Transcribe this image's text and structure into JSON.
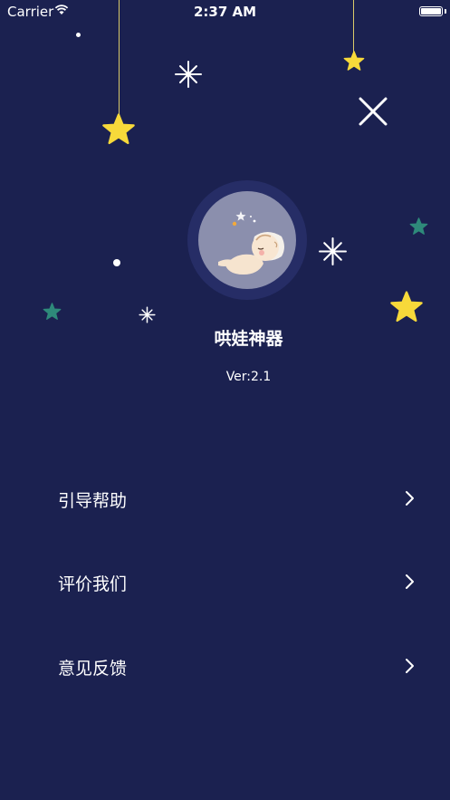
{
  "status_bar": {
    "carrier": "Carrier",
    "time": "2:37 AM"
  },
  "app": {
    "name": "哄娃神器",
    "version": "Ver:2.1"
  },
  "menu": [
    {
      "label": "引导帮助"
    },
    {
      "label": "评价我们"
    },
    {
      "label": "意见反馈"
    }
  ],
  "colors": {
    "background": "#1b2150",
    "star_yellow": "#f7d93a",
    "star_teal": "#2e8a7a",
    "avatar_ring": "#262d66",
    "avatar_fill": "#8b8fad"
  },
  "icons": [
    "wifi-icon",
    "battery-icon",
    "close-icon",
    "sleeping-baby-icon",
    "chevron-right-icon",
    "star-icon",
    "sparkle-icon"
  ]
}
